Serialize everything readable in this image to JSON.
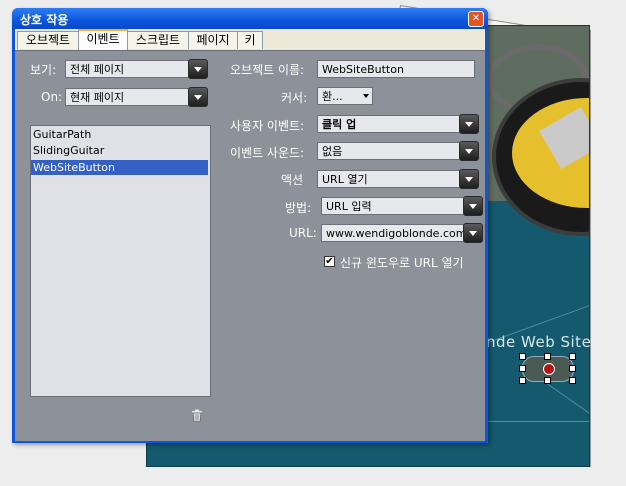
{
  "dialog": {
    "title": "상호 작용",
    "close_glyph": "✕"
  },
  "tabs": [
    {
      "label": "오브젝트"
    },
    {
      "label": "이벤트",
      "active": true
    },
    {
      "label": "스크립트"
    },
    {
      "label": "페이지"
    },
    {
      "label": "키"
    }
  ],
  "left": {
    "view_label": "보기:",
    "view_value": "전체 페이지",
    "on_label": "On:",
    "on_value": "현재 페이지",
    "objects": [
      {
        "name": "GuitarPath"
      },
      {
        "name": "SlidingGuitar"
      },
      {
        "name": "WebSiteButton",
        "selected": true
      }
    ],
    "delete_icon": "trash-icon"
  },
  "right": {
    "object_name_label": "오브젝트 이름:",
    "object_name_value": "WebSiteButton",
    "cursor_label": "커서:",
    "cursor_value": "환...",
    "user_event_label": "사용자 이벤트:",
    "user_event_value": "클릭 업",
    "event_sound_label": "이벤트 사운드:",
    "event_sound_value": "없음",
    "action_label": "액션",
    "action_value": "URL 열기",
    "method_label": "방법:",
    "method_value": "URL 입력",
    "url_label": "URL:",
    "url_value": "www.wendigoblonde.com",
    "new_window_label": "신규 윈도우로 URL 열기",
    "new_window_checked": true,
    "check_glyph": "✔"
  },
  "document": {
    "site_text": "nde Web Site"
  },
  "colors": {
    "title_bar": "#0a56de",
    "panel": "#8d9199",
    "selection": "#3560c6",
    "doc_background": "#14596d"
  }
}
